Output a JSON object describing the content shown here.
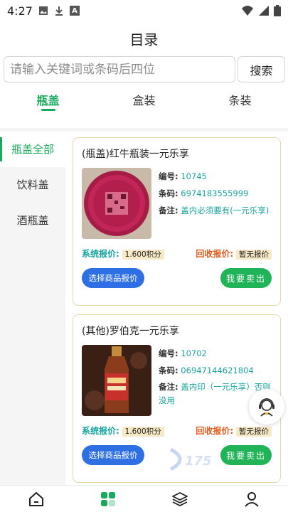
{
  "status_bar": {
    "time": "4:27",
    "mini_letter": "A"
  },
  "header": {
    "title": "目录",
    "search": {
      "placeholder": "请输入关键词或条码后四位",
      "button_label": "搜索"
    },
    "tabs": [
      {
        "label": "瓶盖",
        "active": true
      },
      {
        "label": "盒装"
      },
      {
        "label": "条装"
      }
    ]
  },
  "sidebar": {
    "items": [
      {
        "label": "瓶盖全部",
        "active": true
      },
      {
        "label": "饮料盖"
      },
      {
        "label": "酒瓶盖"
      }
    ]
  },
  "products": [
    {
      "title": "(瓶盖)红牛瓶装一元乐享",
      "code_label": "编号:",
      "code_value": "10745",
      "barcode_label": "条码:",
      "barcode_value": "6974183555999",
      "note_label": "备注:",
      "note_value": "盖内必须要有(一元乐享)",
      "system_price_label": "系统报价:",
      "system_price": "1.600积分",
      "recycle_price_label": "回收报价:",
      "recycle_price": "暂无报价",
      "quote_button": "选择商品报价",
      "sell_button": "我要卖出"
    },
    {
      "title": "(其他)罗伯克一元乐享",
      "code_label": "编号:",
      "code_value": "10702",
      "barcode_label": "条码:",
      "barcode_value": "06947144621804",
      "note_label": "备注:",
      "note_value": "盖内印（一元乐享）否则没用",
      "system_price_label": "系统报价:",
      "system_price": "1.600积分",
      "recycle_price_label": "回收报价:",
      "recycle_price": "暂无报价",
      "quote_button": "选择商品报价",
      "sell_button": "我要卖出"
    }
  ],
  "watermark_text": "175",
  "colors": {
    "accent": "#1aaa5b",
    "teal": "#19a3a0",
    "orange": "#e25a1c",
    "blue": "#2f6fe4",
    "chip": "#f7e9c6"
  },
  "bottom_nav": {
    "items": [
      {
        "icon": "home-icon"
      },
      {
        "icon": "catalog-icon",
        "active": true
      },
      {
        "icon": "layers-icon"
      },
      {
        "icon": "user-icon"
      }
    ]
  }
}
